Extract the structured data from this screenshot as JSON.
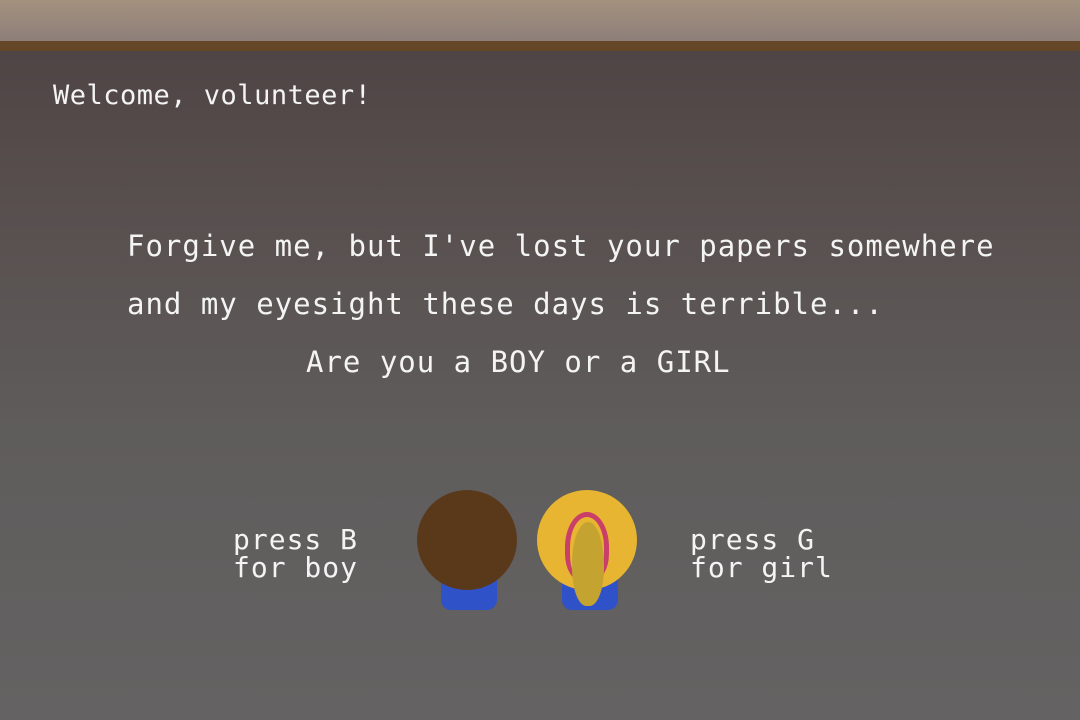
{
  "welcome_text": "Welcome, volunteer!",
  "dialog": {
    "line1": "Forgive me, but I've lost your papers somewhere",
    "line2": "and my eyesight these days is terrible...",
    "line3": "Are you a BOY or a GIRL"
  },
  "choices": {
    "boy": {
      "line1": "press B",
      "line2": "for boy"
    },
    "girl": {
      "line1": "press G",
      "line2": "for girl"
    }
  },
  "colors": {
    "boy_hair": "#5a391a",
    "girl_hair": "#e7b531",
    "ribbon": "#c93f6a",
    "pants": "#2f52c9",
    "trim": "#654626"
  }
}
